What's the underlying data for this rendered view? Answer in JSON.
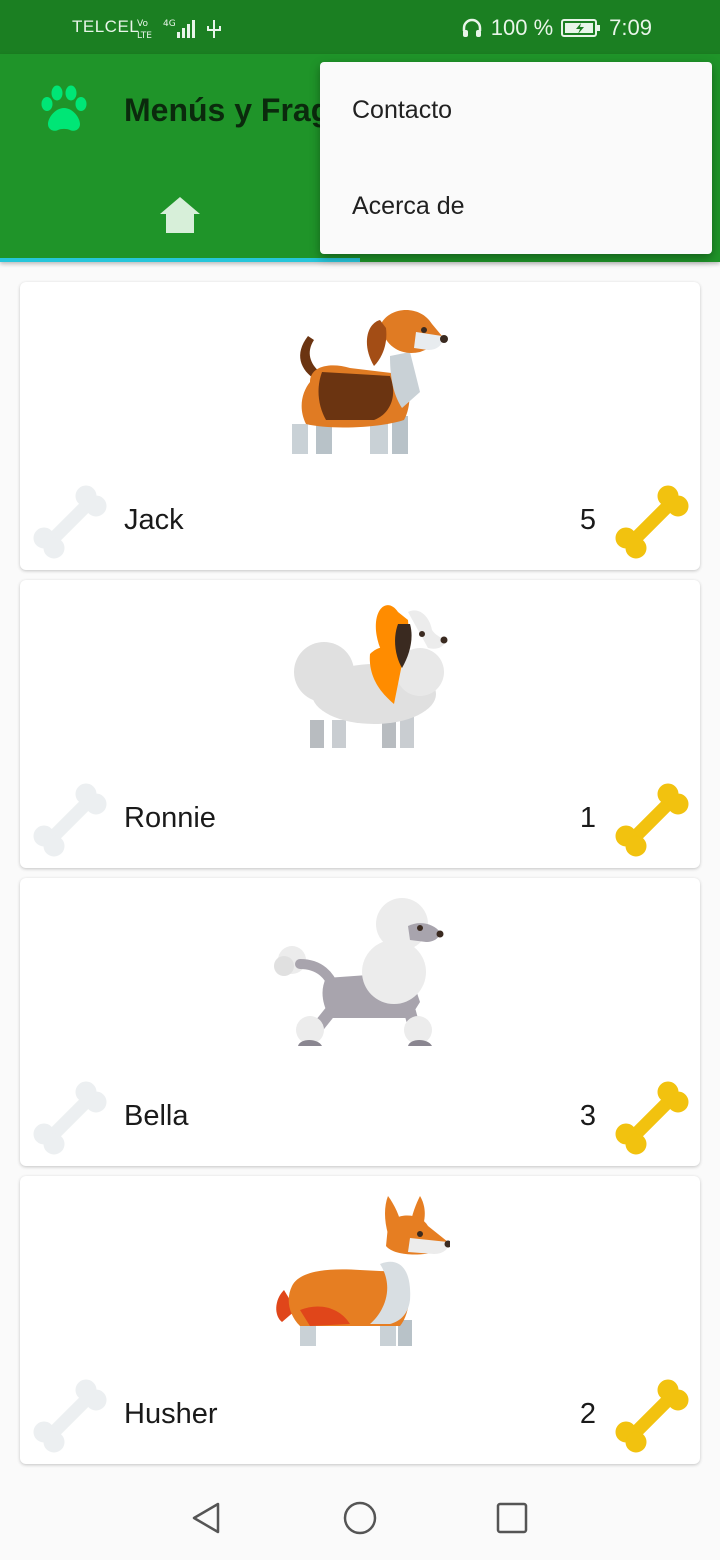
{
  "status_bar": {
    "carrier": "TELCEL",
    "battery_text": "100 %",
    "time": "7:09",
    "icons": [
      "volte-4g-signal-icon",
      "usb-icon",
      "headphones-icon",
      "battery-charging-icon"
    ]
  },
  "app_bar": {
    "title": "Menús y Fragmentos",
    "logo_icon": "paw-icon",
    "tabs": [
      {
        "icon": "home-icon",
        "selected": true
      }
    ],
    "colors": {
      "primary": "#1f9429",
      "primary_dark": "#1b7f22",
      "indicator": "#26c6da",
      "logo": "#00e676"
    }
  },
  "overflow_menu": {
    "items": [
      {
        "label": "Contacto"
      },
      {
        "label": "Acerca de"
      }
    ]
  },
  "dogs": [
    {
      "name": "Jack",
      "rating": "5",
      "breed_icon": "beagle-icon"
    },
    {
      "name": "Ronnie",
      "rating": "1",
      "breed_icon": "papillon-icon"
    },
    {
      "name": "Bella",
      "rating": "3",
      "breed_icon": "poodle-icon"
    },
    {
      "name": "Husher",
      "rating": "2",
      "breed_icon": "corgi-icon"
    }
  ],
  "nav_bar": {
    "icons": [
      "back-icon",
      "home-circle-icon",
      "recents-icon"
    ]
  },
  "colors": {
    "bone_active": "#f2c20f",
    "bone_inactive": "#eceff1"
  }
}
